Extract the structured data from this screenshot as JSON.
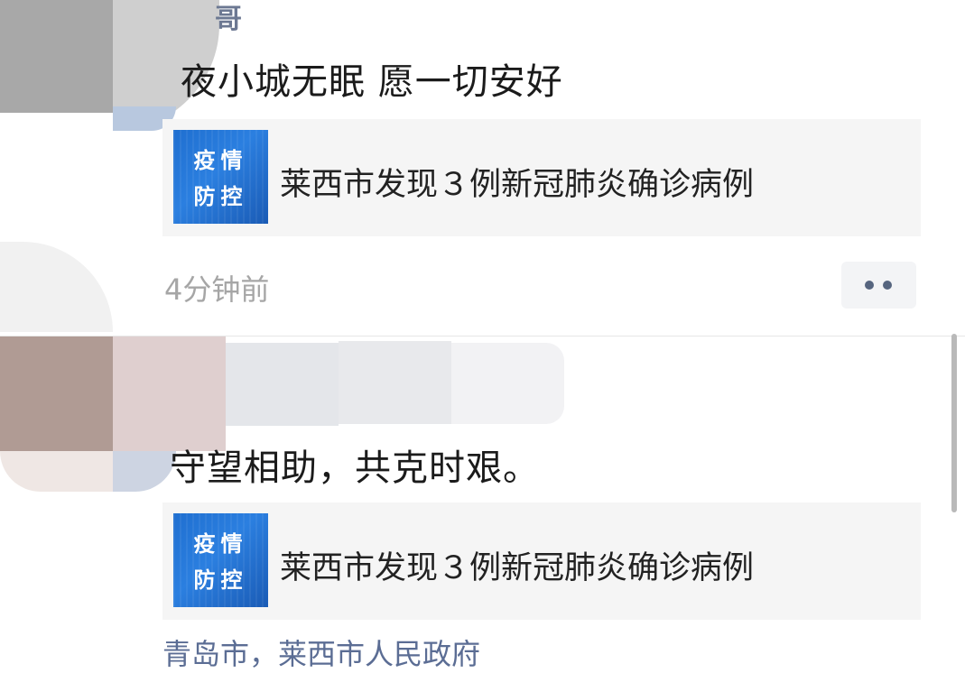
{
  "posts": [
    {
      "author_partial": "哥",
      "text": "夜小城无眠 愿一切安好",
      "link_card": {
        "thumbnail_line1": "疫情",
        "thumbnail_line2": "防控",
        "title": "莱西市发现３例新冠肺炎确诊病例"
      },
      "timestamp": "4分钟前",
      "more_button": "more-dots-icon"
    },
    {
      "text": "守望相助，共克时艰。",
      "link_card": {
        "thumbnail_line1": "疫情",
        "thumbnail_line2": "防控",
        "title": "莱西市发现３例新冠肺炎确诊病例"
      },
      "footer_partial": "青岛市，莱西市人民政府"
    }
  ],
  "colors": {
    "accent_link": "#5b6d94",
    "thumbnail_blue": "#1f6fd0",
    "card_bg": "#f5f5f5"
  }
}
